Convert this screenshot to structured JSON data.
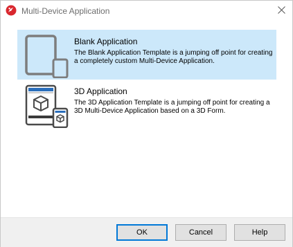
{
  "window": {
    "title": "Multi-Device Application",
    "app_icon": "delphi-logo-icon",
    "close_icon": "close-icon"
  },
  "templates": [
    {
      "title": "Blank Application",
      "description": "The Blank Application Template is a jumping off point for creating a completely custom Multi-Device Application.",
      "icon": "blank-devices-icon",
      "selected": true
    },
    {
      "title": "3D Application",
      "description": "The 3D Application Template is a jumping off point for creating a 3D Multi-Device Application based on a 3D Form.",
      "icon": "3d-devices-icon",
      "selected": false
    }
  ],
  "buttons": {
    "ok": "OK",
    "cancel": "Cancel",
    "help": "Help"
  },
  "colors": {
    "selection": "#cce8fa",
    "default_button_border": "#0078d7",
    "footer_background": "#f0f0f0",
    "brand_red": "#d9272e"
  }
}
